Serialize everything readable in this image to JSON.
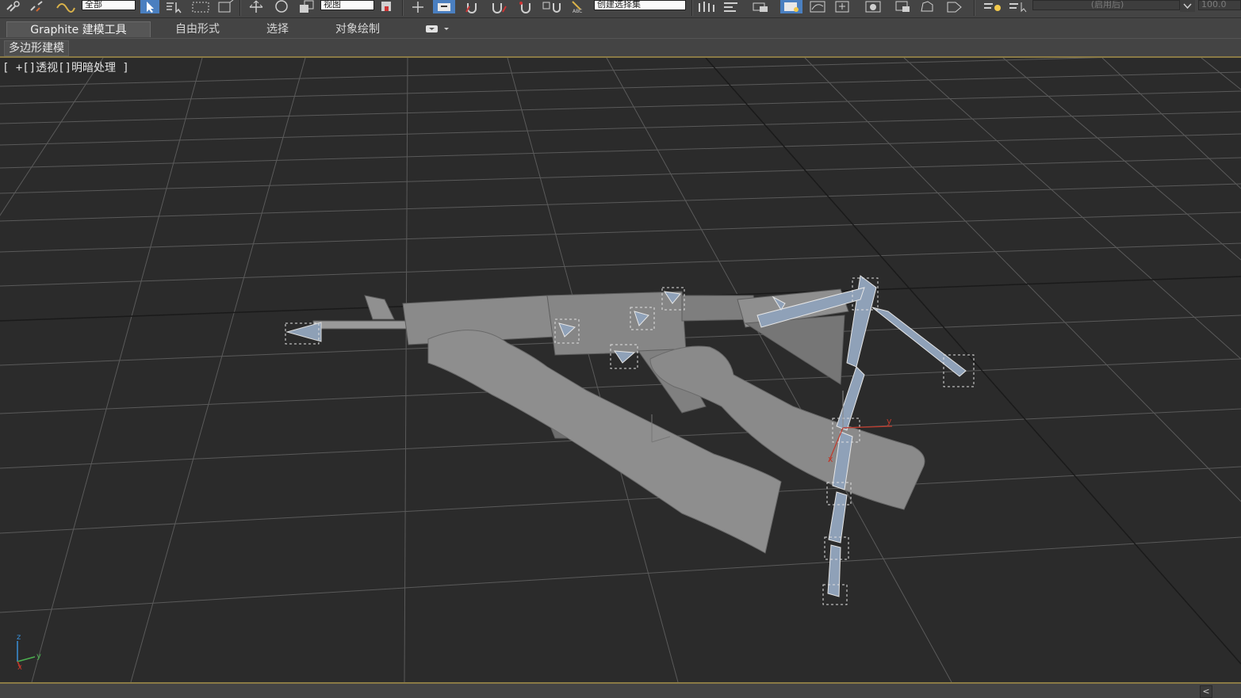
{
  "toolbar": {
    "selection_filter": "全部",
    "ref_coord": "视图",
    "named_selection": "创建选择集",
    "disabled_field": "(启用后)",
    "spinner_value": "100.0"
  },
  "ribbon": {
    "tabs": [
      "Graphite 建模工具",
      "自由形式",
      "选择",
      "对象绘制"
    ],
    "panel_label": "多边形建模"
  },
  "viewport": {
    "label": "[ +[]透视[]明暗处理 ]",
    "axis_labels": {
      "z": "z",
      "y": "y",
      "x": "x"
    }
  },
  "status": {
    "scroll_left": "<"
  },
  "colors": {
    "background": "#2b2b2b",
    "grid": "#595959",
    "accent": "#8a7a45",
    "model": "#8c8c8c"
  }
}
